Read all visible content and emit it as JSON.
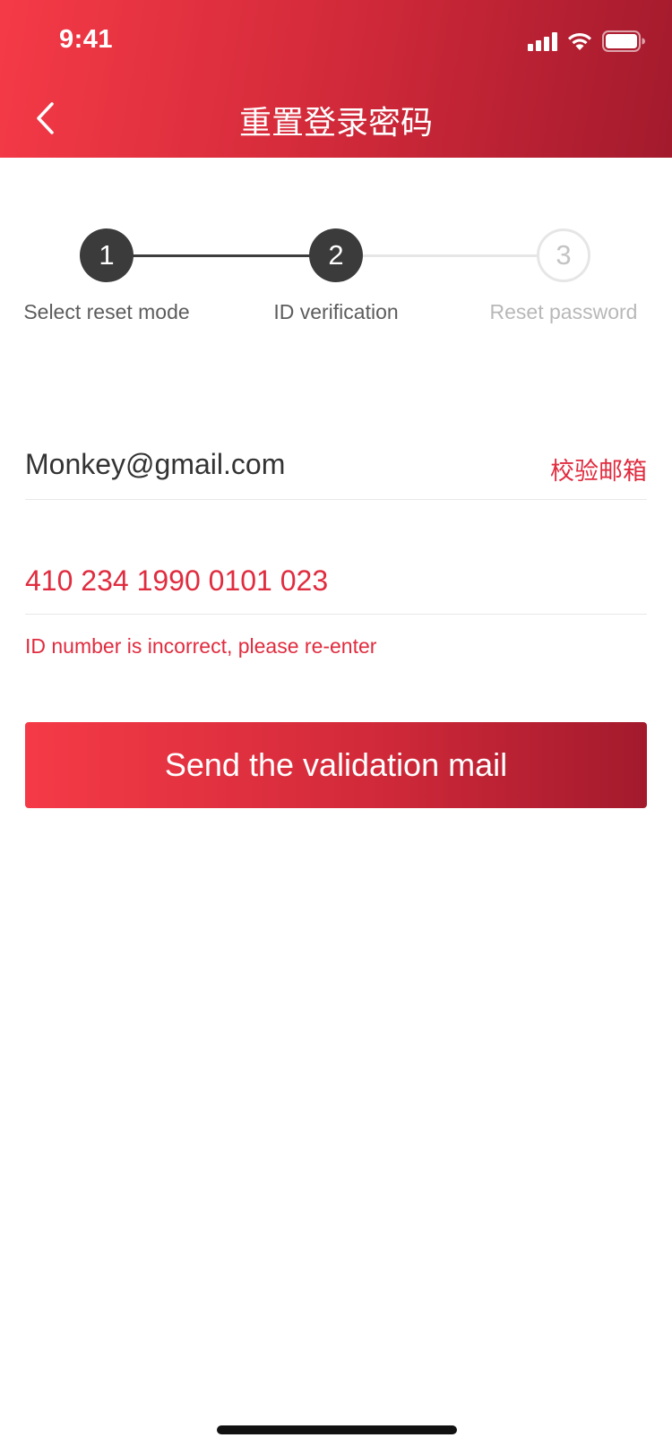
{
  "status_bar": {
    "time": "9:41",
    "icons": [
      "signal-icon",
      "wifi-icon",
      "battery-icon"
    ]
  },
  "nav": {
    "back_icon": "chevron-left-icon",
    "title": "重置登录密码"
  },
  "stepper": {
    "steps": [
      {
        "number": "1",
        "label": "Select reset mode",
        "state": "completed"
      },
      {
        "number": "2",
        "label": "ID verification",
        "state": "current"
      },
      {
        "number": "3",
        "label": "Reset password",
        "state": "pending"
      }
    ]
  },
  "form": {
    "email": {
      "value": "Monkey@gmail.com",
      "action_label": "校验邮箱"
    },
    "id_number": {
      "value": "410 234 1990 0101 023",
      "error": "ID number is incorrect, please re-enter"
    }
  },
  "send_button": {
    "label": "Send the validation mail"
  },
  "colors": {
    "accent": "#e02c3f",
    "gradient_start": "#f53a47",
    "gradient_end": "#a31a2d",
    "step_active": "#3b3b3b",
    "step_inactive": "#e6e6e6"
  }
}
